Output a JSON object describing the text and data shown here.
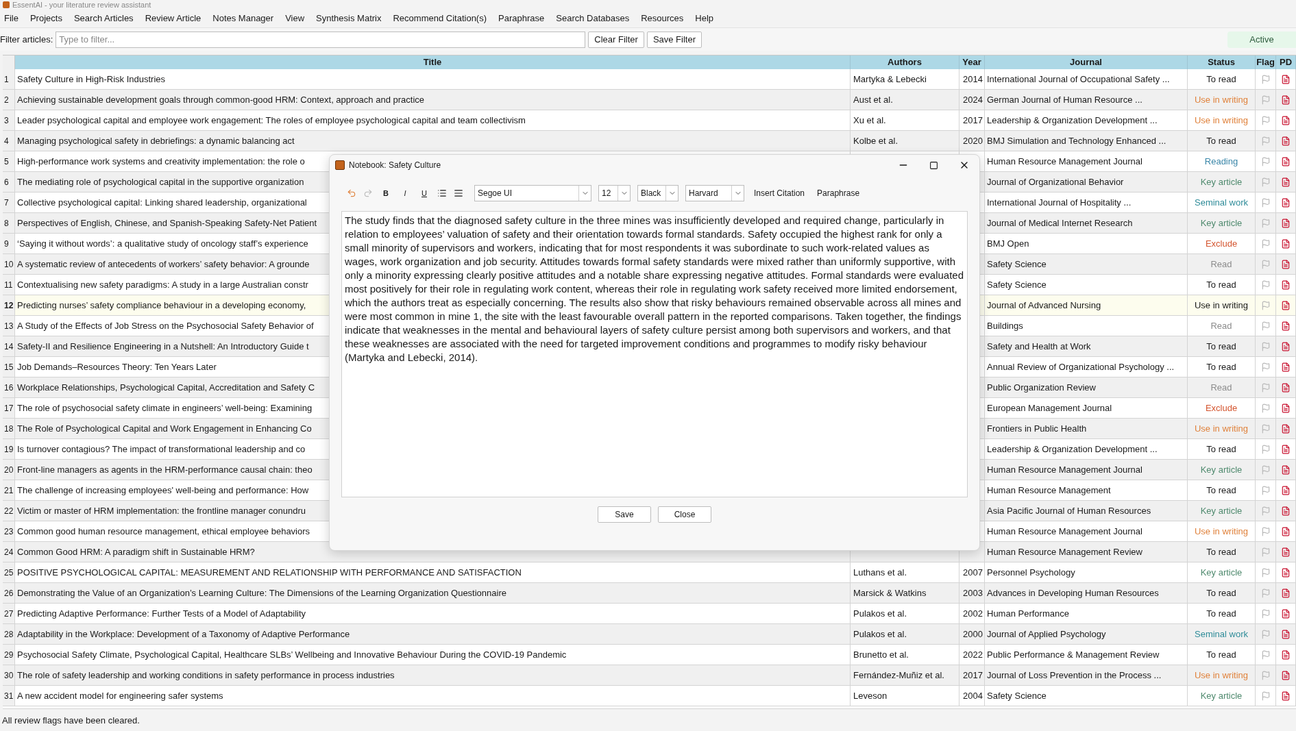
{
  "window": {
    "title": "EssentAI - your literature review assistant"
  },
  "menu": [
    "File",
    "Projects",
    "Search Articles",
    "Review Article",
    "Notes Manager",
    "View",
    "Synthesis Matrix",
    "Recommend Citation(s)",
    "Paraphrase",
    "Search Databases",
    "Resources",
    "Help"
  ],
  "filter": {
    "label": "Filter articles:",
    "placeholder": "Type to filter...",
    "buttons": [
      "Clear Filter",
      "Save Filter"
    ],
    "badge": "Active"
  },
  "table": {
    "columns": [
      "Title",
      "Authors",
      "Year",
      "Journal",
      "Status",
      "Flag",
      "PD"
    ],
    "rows": [
      {
        "n": "1",
        "title": "Safety Culture in High-Risk Industries",
        "authors": "Martyka & Lebecki",
        "year": "2014",
        "journal": "International Journal of Occupational Safety ...",
        "status": "To read",
        "color": "#1a1a1a",
        "selected": false
      },
      {
        "n": "2",
        "title": "Achieving sustainable development goals through common-good HRM: Context, approach and practice",
        "authors": "Aust et al.",
        "year": "2024",
        "journal": "German Journal of Human Resource ...",
        "status": "Use in writing",
        "color": "#e0823c",
        "selected": false
      },
      {
        "n": "3",
        "title": "Leader psychological capital and employee work engagement: The roles of employee psychological capital and team collectivism",
        "authors": "Xu et al.",
        "year": "2017",
        "journal": "Leadership & Organization Development ...",
        "status": "Use in writing",
        "color": "#e0823c",
        "selected": false
      },
      {
        "n": "4",
        "title": "Managing psychological safety in debriefings: a dynamic balancing act",
        "authors": "Kolbe et al.",
        "year": "2020",
        "journal": "BMJ Simulation and Technology Enhanced ...",
        "status": "To read",
        "color": "#1a1a1a",
        "selected": false
      },
      {
        "n": "5",
        "title": "High-performance work systems and creativity implementation: the role o",
        "journal": "Human Resource Management Journal",
        "status": "Reading",
        "color": "#3a86a8",
        "selected": false
      },
      {
        "n": "6",
        "title": "The mediating role of psychological capital in the supportive organization",
        "journal": "Journal of Organizational Behavior",
        "status": "Key article",
        "color": "#4f8a6e",
        "selected": false
      },
      {
        "n": "7",
        "title": "Collective psychological capital: Linking shared leadership, organizational",
        "journal": "International Journal of Hospitality ...",
        "status": "Seminal work",
        "color": "#2f8c99",
        "selected": false
      },
      {
        "n": "8",
        "title": "Perspectives of English, Chinese, and Spanish-Speaking Safety-Net Patient",
        "journal": "Journal of Medical Internet Research",
        "status": "Key article",
        "color": "#4f8a6e",
        "selected": false
      },
      {
        "n": "9",
        "title": "‘Saying it without words’: a qualitative study of oncology staff’s experience",
        "journal": "BMJ Open",
        "status": "Exclude",
        "color": "#d4552f",
        "selected": false
      },
      {
        "n": "10",
        "title": "A systematic review of antecedents of workers’ safety behavior: A grounde",
        "journal": "Safety Science",
        "status": "Read",
        "color": "#8c8c8c",
        "selected": false
      },
      {
        "n": "11",
        "title": "Contextualising new safety paradigms: A study in a large Australian constr",
        "journal": "Safety Science",
        "status": "To read",
        "color": "#1a1a1a",
        "selected": false
      },
      {
        "n": "12",
        "title": "Predicting nurses’ safety compliance behaviour in a developing economy,",
        "journal": "Journal of Advanced Nursing",
        "status": "Use in writing",
        "color": "#1a1a1a",
        "selected": true
      },
      {
        "n": "13",
        "title": "A Study of the Effects of Job Stress on the Psychosocial Safety Behavior of",
        "journal": "Buildings",
        "status": "Read",
        "color": "#8c8c8c",
        "selected": false
      },
      {
        "n": "14",
        "title": "Safety-II and Resilience Engineering in a Nutshell: An Introductory Guide t",
        "journal": "Safety and Health at Work",
        "status": "To read",
        "color": "#1a1a1a",
        "selected": false
      },
      {
        "n": "15",
        "title": "Job Demands–Resources Theory: Ten Years Later",
        "journal": "Annual Review of Organizational Psychology ...",
        "status": "To read",
        "color": "#1a1a1a",
        "selected": false
      },
      {
        "n": "16",
        "title": "Workplace Relationships, Psychological Capital, Accreditation and Safety C",
        "journal": "Public Organization Review",
        "status": "Read",
        "color": "#8c8c8c",
        "selected": false
      },
      {
        "n": "17",
        "title": "The role of psychosocial safety climate in engineers’ well-being: Examining",
        "journal": "European Management Journal",
        "status": "Exclude",
        "color": "#d4552f",
        "selected": false
      },
      {
        "n": "18",
        "title": "The Role of Psychological Capital and Work Engagement in Enhancing Co",
        "journal": "Frontiers in Public Health",
        "status": "Use in writing",
        "color": "#e0823c",
        "selected": false
      },
      {
        "n": "19",
        "title": "Is turnover contagious? The impact of transformational leadership and co",
        "journal": "Leadership & Organization Development ...",
        "status": "To read",
        "color": "#1a1a1a",
        "selected": false
      },
      {
        "n": "20",
        "title": "Front-line managers as agents in the HRM-performance causal chain: theo",
        "journal": "Human Resource Management Journal",
        "status": "Key article",
        "color": "#4f8a6e",
        "selected": false
      },
      {
        "n": "21",
        "title": "The challenge of increasing employees' well-being and performance: How",
        "journal": "Human Resource Management",
        "status": "To read",
        "color": "#1a1a1a",
        "selected": false
      },
      {
        "n": "22",
        "title": "Victim or master of HRM implementation: the frontline manager conundru",
        "journal": "Asia Pacific Journal of Human Resources",
        "status": "Key article",
        "color": "#4f8a6e",
        "selected": false
      },
      {
        "n": "23",
        "title": "Common good human resource management, ethical employee behaviors",
        "journal": "Human Resource Management Journal",
        "status": "Use in writing",
        "color": "#e0823c",
        "selected": false
      },
      {
        "n": "24",
        "title": "Common Good HRM: A paradigm shift in Sustainable HRM?",
        "journal": "Human Resource Management Review",
        "status": "To read",
        "color": "#1a1a1a",
        "selected": false
      },
      {
        "n": "25",
        "title": "POSITIVE PSYCHOLOGICAL CAPITAL: MEASUREMENT AND RELATIONSHIP WITH PERFORMANCE AND SATISFACTION",
        "authors": "Luthans et al.",
        "year": "2007",
        "journal": "Personnel Psychology",
        "status": "Key article",
        "color": "#4f8a6e",
        "selected": false
      },
      {
        "n": "26",
        "title": "Demonstrating the Value of an Organization’s Learning Culture: The Dimensions of the Learning Organization Questionnaire",
        "authors": "Marsick & Watkins",
        "year": "2003",
        "journal": "Advances in Developing Human Resources",
        "status": "To read",
        "color": "#1a1a1a",
        "selected": false
      },
      {
        "n": "27",
        "title": "Predicting Adaptive Performance: Further Tests of a Model of Adaptability",
        "authors": "Pulakos et al.",
        "year": "2002",
        "journal": "Human Performance",
        "status": "To read",
        "color": "#1a1a1a",
        "selected": false
      },
      {
        "n": "28",
        "title": "Adaptability in the Workplace: Development of a Taxonomy of Adaptive Performance",
        "authors": "Pulakos et al.",
        "year": "2000",
        "journal": "Journal of Applied Psychology",
        "status": "Seminal work",
        "color": "#2f8c99",
        "selected": false
      },
      {
        "n": "29",
        "title": "Psychosocial Safety Climate, Psychological Capital, Healthcare SLBs’ Wellbeing and Innovative Behaviour During the COVID-19 Pandemic",
        "authors": "Brunetto et al.",
        "year": "2022",
        "journal": "Public Performance & Management Review",
        "status": "To read",
        "color": "#1a1a1a",
        "selected": false
      },
      {
        "n": "30",
        "title": "The role of safety leadership and working conditions in safety performance in process industries",
        "authors": "Fernández-Muñiz et al.",
        "year": "2017",
        "journal": "Journal of Loss Prevention in the Process ...",
        "status": "Use in writing",
        "color": "#e0823c",
        "selected": false
      },
      {
        "n": "31",
        "title": "A new accident model for engineering safer systems",
        "authors": "Leveson",
        "year": "2004",
        "journal": "Safety Science",
        "status": "Key article",
        "color": "#4f8a6e",
        "selected": false
      }
    ]
  },
  "dialog": {
    "title": "Notebook: Safety Culture",
    "format_buttons": [
      "B",
      "I",
      "U"
    ],
    "font": "Segoe UI",
    "size": "12",
    "text_color": "Black",
    "style": "Harvard",
    "actions": [
      "Insert Citation",
      "Paraphrase"
    ],
    "text": "The study finds that the diagnosed safety culture in the three mines was insufficiently developed and required change, particularly in relation to employees’ valuation of safety and their orientation towards formal standards. Safety occupied the highest rank for only a small minority of supervisors and workers, indicating that for most respondents it was subordinate to such work-related values as wages, work organization and job security. Attitudes towards formal safety standards were mixed rather than uniformly supportive, with only a minority expressing clearly positive attitudes and a notable share expressing negative attitudes. Formal standards were evaluated most positively for their role in regulating work content, whereas their role in regulating work safety received more limited endorsement, which the authors treat as especially concerning. The results also show that risky behaviours remained observable across all mines and were most common in mine 1, the site with the least favourable overall pattern in the reported comparisons. Taken together, the findings indicate that weaknesses in the mental and behavioural layers of safety culture persist among both supervisors and workers, and that these weaknesses are associated with the need for targeted improvement conditions and programmes to modify risky behaviour (Martyka and Lebecki, 2014).",
    "buttons": [
      "Save",
      "Close"
    ]
  },
  "status_bar": "All review flags have been cleared."
}
